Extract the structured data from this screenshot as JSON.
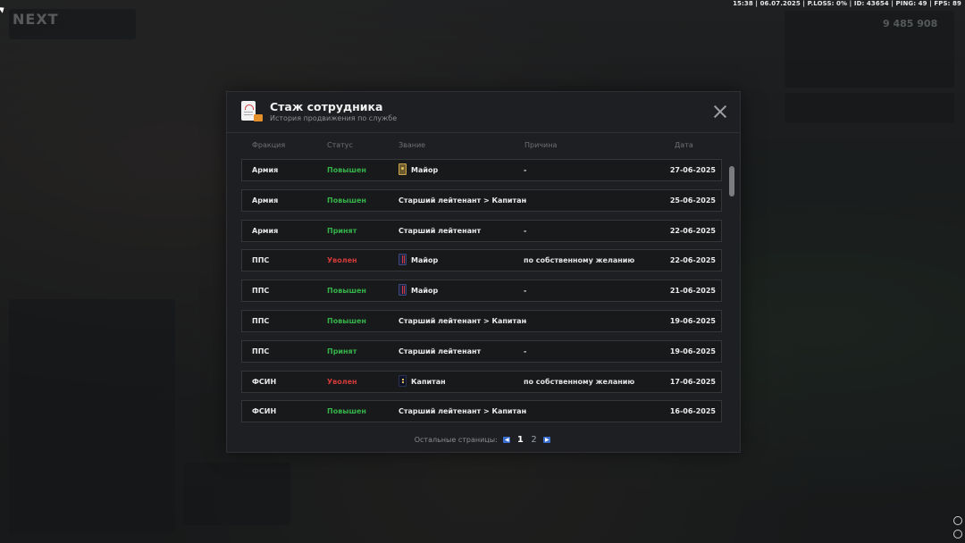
{
  "hud": {
    "status_line": "15:38 | 06.07.2025 | P.LOSS: 0% | ID: 43654 | PING: 49 | FPS: 89",
    "logo": "NEXT",
    "money": "9 485 908"
  },
  "modal": {
    "title": "Стаж сотрудника",
    "subtitle": "История продвижения по службе",
    "columns": {
      "faction": "Фракция",
      "status": "Статус",
      "rank": "Звание",
      "reason": "Причина",
      "date": "Дата"
    },
    "rows": [
      {
        "faction": "Армия",
        "status": "Повышен",
        "status_type": "up",
        "insignia": "army",
        "rank": "Майор",
        "reason": "-",
        "date": "27-06-2025"
      },
      {
        "faction": "Армия",
        "status": "Повышен",
        "status_type": "up",
        "insignia": "",
        "rank": "Старший лейтенант > Капитан",
        "reason": "-",
        "date": "25-06-2025"
      },
      {
        "faction": "Армия",
        "status": "Принят",
        "status_type": "in",
        "insignia": "",
        "rank": "Старший лейтенант",
        "reason": "-",
        "date": "22-06-2025"
      },
      {
        "faction": "ППС",
        "status": "Уволен",
        "status_type": "fired",
        "insignia": "pps",
        "rank": "Майор",
        "reason": "по собственному желанию",
        "date": "22-06-2025"
      },
      {
        "faction": "ППС",
        "status": "Повышен",
        "status_type": "up",
        "insignia": "pps",
        "rank": "Майор",
        "reason": "-",
        "date": "21-06-2025"
      },
      {
        "faction": "ППС",
        "status": "Повышен",
        "status_type": "up",
        "insignia": "",
        "rank": "Старший лейтенант > Капитан",
        "reason": "-",
        "date": "19-06-2025"
      },
      {
        "faction": "ППС",
        "status": "Принят",
        "status_type": "in",
        "insignia": "",
        "rank": "Старший лейтенант",
        "reason": "-",
        "date": "19-06-2025"
      },
      {
        "faction": "ФСИН",
        "status": "Уволен",
        "status_type": "fired",
        "insignia": "fsin",
        "rank": "Капитан",
        "reason": "по собственному желанию",
        "date": "17-06-2025"
      },
      {
        "faction": "ФСИН",
        "status": "Повышен",
        "status_type": "up",
        "insignia": "",
        "rank": "Старший лейтенант > Капитан",
        "reason": "-",
        "date": "16-06-2025"
      }
    ],
    "pager": {
      "label": "Остальные страницы:",
      "prev_icon": "chevron-left-icon",
      "next_icon": "chevron-right-icon",
      "pages": [
        "1",
        "2"
      ],
      "current": "1"
    }
  },
  "colors": {
    "status_up": "#35b34a",
    "status_fired": "#d33a3a",
    "pager_arrow": "#3a6fd0"
  }
}
